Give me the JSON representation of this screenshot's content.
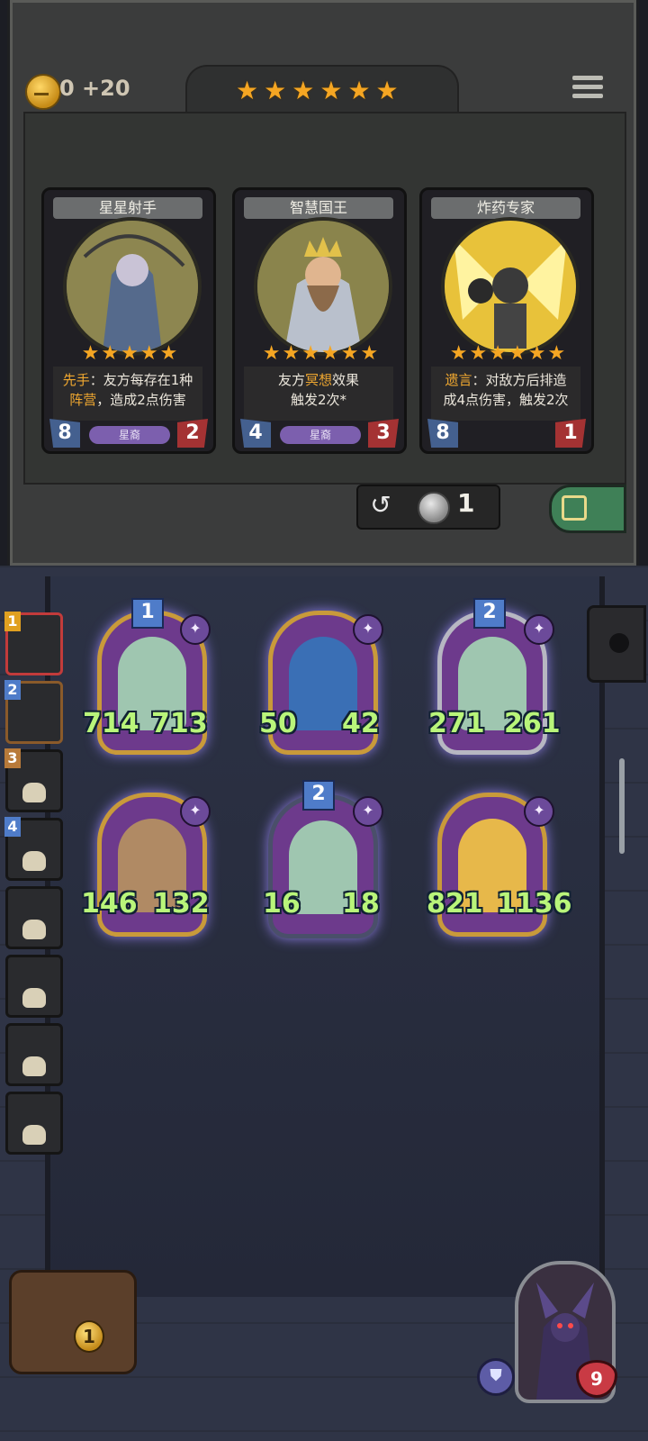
{
  "shop": {
    "gold_text": "0 +20",
    "star_count": 6,
    "refresh_cost": "1",
    "cards": [
      {
        "name": "星星射手",
        "stars": 5,
        "desc_pre": "先手",
        "desc_mid": "：友方每存在1种",
        "desc_hl2": "阵营",
        "desc_post": "，造成2点伤害",
        "tribe": "星裔",
        "attack": "8",
        "health": "2"
      },
      {
        "name": "智慧国王",
        "stars": 6,
        "desc_pre": "友方",
        "desc_mid": "冥想",
        "desc_hl2": "效果",
        "desc_post": "触发2次*",
        "tribe": "星裔",
        "attack": "4",
        "health": "3"
      },
      {
        "name": "炸药专家",
        "stars": 6,
        "desc_pre": "遗言",
        "desc_mid": "：对敌方后排造",
        "desc_hl2": "",
        "desc_post": "成4点伤害，触发2次",
        "tribe": "",
        "attack": "8",
        "health": "1"
      }
    ]
  },
  "board": {
    "minions": [
      {
        "attack": "714",
        "health": "713",
        "tier": "1"
      },
      {
        "attack": "50",
        "health": "42",
        "tier": ""
      },
      {
        "attack": "271",
        "health": "261",
        "tier": "2"
      },
      {
        "attack": "146",
        "health": "132",
        "tier": ""
      },
      {
        "attack": "16",
        "health": "18",
        "tier": "2"
      },
      {
        "attack": "821",
        "health": "1136",
        "tier": ""
      }
    ]
  },
  "sidebar": {
    "players": [
      {
        "rank": "1"
      },
      {
        "rank": "2"
      },
      {
        "rank": "3"
      },
      {
        "rank": "4"
      },
      {
        "rank": ""
      },
      {
        "rank": ""
      },
      {
        "rank": ""
      },
      {
        "rank": ""
      }
    ]
  },
  "bottom": {
    "tavern_level": "1",
    "hero_health": "9"
  },
  "icons": {
    "refresh": "↺",
    "lock": "🔒",
    "shield": "⛊",
    "star": "★",
    "purple_badge": "✦"
  },
  "colors": {
    "gold": "#f5a623",
    "attack_blue": "#44608f",
    "health_red": "#a43233",
    "stat_green": "#b9f57a",
    "tribe_purple": "#7c5fae"
  }
}
